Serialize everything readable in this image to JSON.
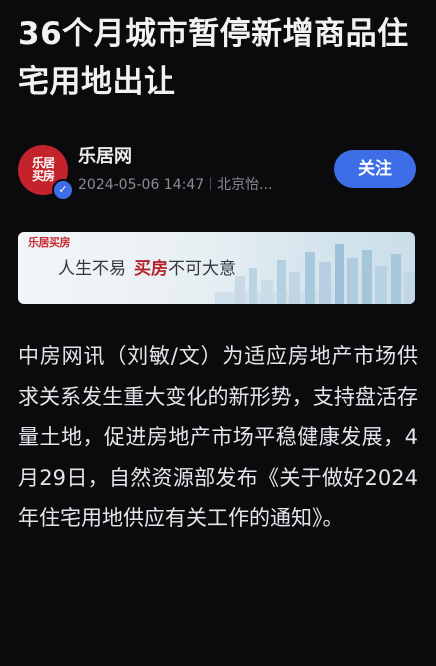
{
  "article": {
    "title": "36个月城市暂停新增商品住宅用地出让",
    "body": "中房网讯（刘敏/文）为适应房地产市场供求关系发生重大变化的新形势，支持盘活存量土地，促进房地产市场平稳健康发展，4月29日，自然资源部发布《关于做好2024年住宅用地供应有关工作的通知》。"
  },
  "author": {
    "name": "乐居网",
    "avatar_text_line1": "乐居",
    "avatar_text_line2": "买房",
    "verified_icon": "check-badge-icon",
    "date": "2024-05-06 14:47",
    "location": "北京怡..."
  },
  "follow_button": {
    "label": "关注"
  },
  "banner": {
    "logo_text": "乐居买房",
    "slogan_start": "人生不易",
    "slogan_highlight": "买房",
    "slogan_end": "不可大意"
  },
  "colors": {
    "background": "#0b0b0d",
    "accent": "#3d6ee8",
    "brand_red": "#c5232c"
  }
}
